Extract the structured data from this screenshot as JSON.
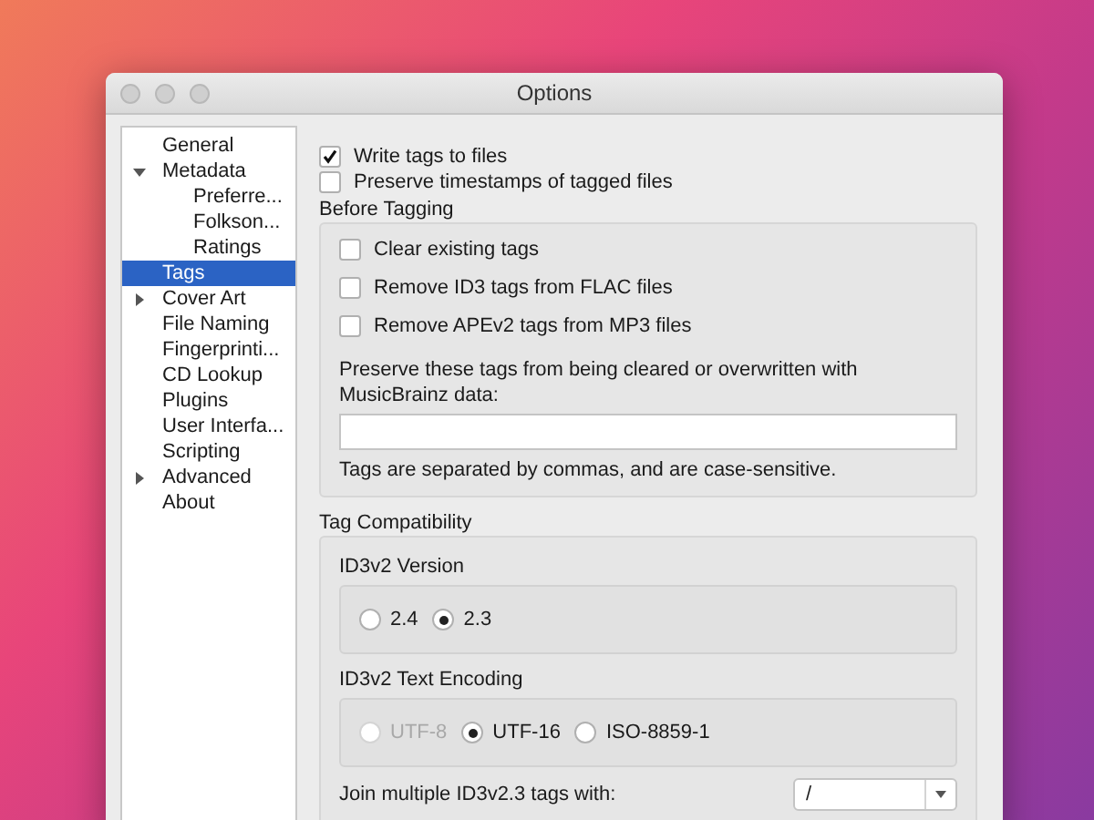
{
  "window": {
    "title": "Options"
  },
  "sidebar": {
    "items": [
      {
        "label": "General",
        "kind": "page",
        "selected": false
      },
      {
        "label": "Metadata",
        "kind": "group",
        "expanded": true,
        "selected": false,
        "children": [
          {
            "label": "Preferre...",
            "kind": "page",
            "selected": false
          },
          {
            "label": "Folkson...",
            "kind": "page",
            "selected": false
          },
          {
            "label": "Ratings",
            "kind": "page",
            "selected": false
          }
        ]
      },
      {
        "label": "Tags",
        "kind": "page",
        "selected": true
      },
      {
        "label": "Cover Art",
        "kind": "group",
        "expanded": false,
        "selected": false
      },
      {
        "label": "File Naming",
        "kind": "page",
        "selected": false
      },
      {
        "label": "Fingerprinti...",
        "kind": "page",
        "selected": false
      },
      {
        "label": "CD Lookup",
        "kind": "page",
        "selected": false
      },
      {
        "label": "Plugins",
        "kind": "page",
        "selected": false
      },
      {
        "label": "User Interfa...",
        "kind": "page",
        "selected": false
      },
      {
        "label": "Scripting",
        "kind": "page",
        "selected": false
      },
      {
        "label": "Advanced",
        "kind": "group",
        "expanded": false,
        "selected": false
      },
      {
        "label": "About",
        "kind": "page",
        "selected": false
      }
    ]
  },
  "options": [
    {
      "label": "Write tags to files",
      "checked": true
    },
    {
      "label": "Preserve timestamps of tagged files",
      "checked": false
    }
  ],
  "before_tagging": {
    "title": "Before Tagging",
    "options": [
      {
        "label": "Clear existing tags",
        "checked": false
      },
      {
        "label": "Remove ID3 tags from FLAC files",
        "checked": false
      },
      {
        "label": "Remove APEv2 tags from MP3 files",
        "checked": false
      }
    ],
    "preserve_label": "Preserve these tags from being cleared or overwritten with MusicBrainz data:",
    "hint": "Tags are separated by commas, and are case-sensitive."
  },
  "tag_compatibility": {
    "title": "Tag Compatibility",
    "version": {
      "title": "ID3v2 Version",
      "options": [
        {
          "label": "2.4",
          "selected": false,
          "disabled": false
        },
        {
          "label": "2.3",
          "selected": true,
          "disabled": false
        }
      ]
    },
    "encoding": {
      "title": "ID3v2 Text Encoding",
      "options": [
        {
          "label": "UTF-8",
          "selected": false,
          "disabled": true
        },
        {
          "label": "UTF-16",
          "selected": true,
          "disabled": false
        },
        {
          "label": "ISO-8859-1",
          "selected": false,
          "disabled": false
        }
      ]
    },
    "join": {
      "label": "Join multiple ID3v2.3 tags with:",
      "value": "/"
    }
  }
}
